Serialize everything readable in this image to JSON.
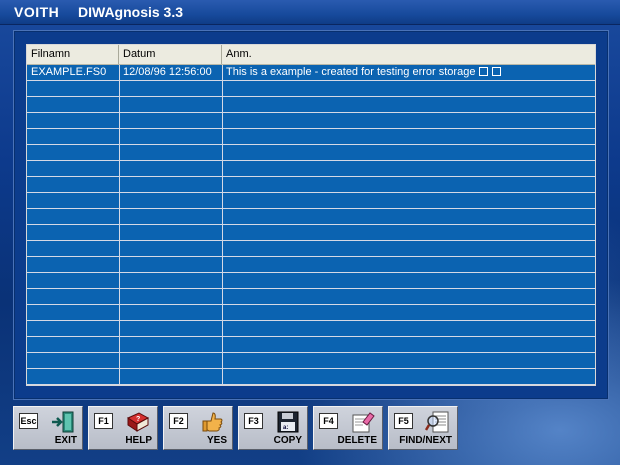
{
  "window": {
    "brand": "VOITH",
    "title": "DIWAgnosis 3.3"
  },
  "table": {
    "columns": [
      "Filnamn",
      "Datum",
      "Anm."
    ],
    "rows": [
      {
        "filename": "EXAMPLE.FS0",
        "date": "12/08/96  12:56:00",
        "note": "This is a example - created for testing error storage"
      }
    ]
  },
  "toolbar": {
    "buttons": [
      {
        "key": "Esc",
        "label": "EXIT",
        "icon": "exit-door-icon"
      },
      {
        "key": "F1",
        "label": "HELP",
        "icon": "help-book-icon"
      },
      {
        "key": "F2",
        "label": "YES",
        "icon": "thumbs-up-icon"
      },
      {
        "key": "F3",
        "label": "COPY",
        "icon": "floppy-disk-icon"
      },
      {
        "key": "F4",
        "label": "DELETE",
        "icon": "eraser-icon"
      },
      {
        "key": "F5",
        "label": "FIND/NEXT",
        "icon": "magnifier-document-icon"
      }
    ]
  },
  "colors": {
    "background": "#0d3a8c",
    "grid": "#0b63b1",
    "header": "#ecebe0",
    "button": "#c4c8d1"
  }
}
